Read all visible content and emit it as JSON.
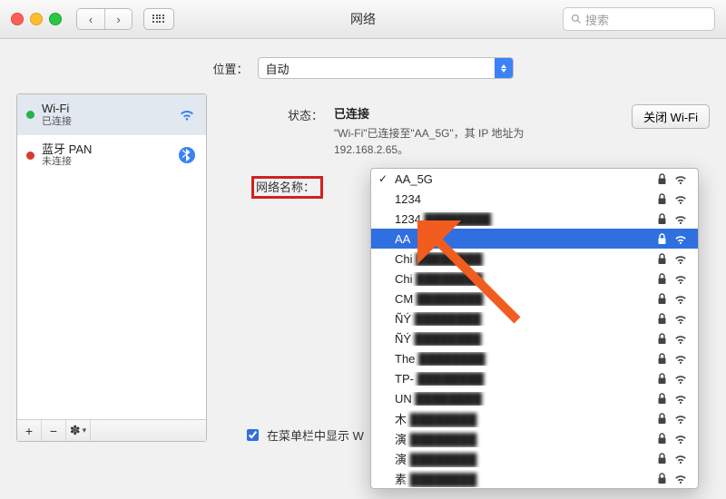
{
  "window": {
    "title": "网络",
    "search_placeholder": "搜索"
  },
  "location": {
    "label": "位置：",
    "value": "自动"
  },
  "sidebar": {
    "items": [
      {
        "name": "Wi-Fi",
        "sub": "已连接",
        "status": "green",
        "icon": "wifi"
      },
      {
        "name": "蓝牙 PAN",
        "sub": "未连接",
        "status": "red",
        "icon": "bluetooth"
      }
    ],
    "footer": {
      "add": "+",
      "remove": "−",
      "gear": "✽"
    }
  },
  "main": {
    "status_label": "状态：",
    "status_value": "已连接",
    "status_desc": "\"Wi-Fi\"已连接至\"AA_5G\"，其 IP 地址为 192.168.2.65。",
    "toggle_button": "关闭 Wi-Fi",
    "netname_label": "网络名称：",
    "show_in_menu": "在菜单栏中显示 W"
  },
  "networks": {
    "current": "AA_5G",
    "list": [
      {
        "name": "AA_5G",
        "locked": true,
        "selected": false,
        "current": true
      },
      {
        "name": "1234",
        "locked": true,
        "censored": false
      },
      {
        "name": "1234",
        "locked": true,
        "censored": true
      },
      {
        "name": "AA",
        "locked": true,
        "selected": true
      },
      {
        "name": "Chi",
        "locked": true,
        "censored": true
      },
      {
        "name": "Chi",
        "locked": true,
        "censored": true
      },
      {
        "name": "CM",
        "locked": true,
        "censored": true
      },
      {
        "name": "ÑÝ",
        "locked": true,
        "censored": true
      },
      {
        "name": "ÑÝ",
        "locked": true,
        "censored": true
      },
      {
        "name": "The",
        "locked": true,
        "censored": true
      },
      {
        "name": "TP-",
        "locked": true,
        "censored": true
      },
      {
        "name": "UN",
        "locked": true,
        "censored": true
      },
      {
        "name": "木",
        "locked": true,
        "censored": true
      },
      {
        "name": "演",
        "locked": true,
        "censored": true
      },
      {
        "name": "演",
        "locked": true,
        "censored": true
      },
      {
        "name": "素",
        "locked": true,
        "censored": true
      }
    ]
  }
}
